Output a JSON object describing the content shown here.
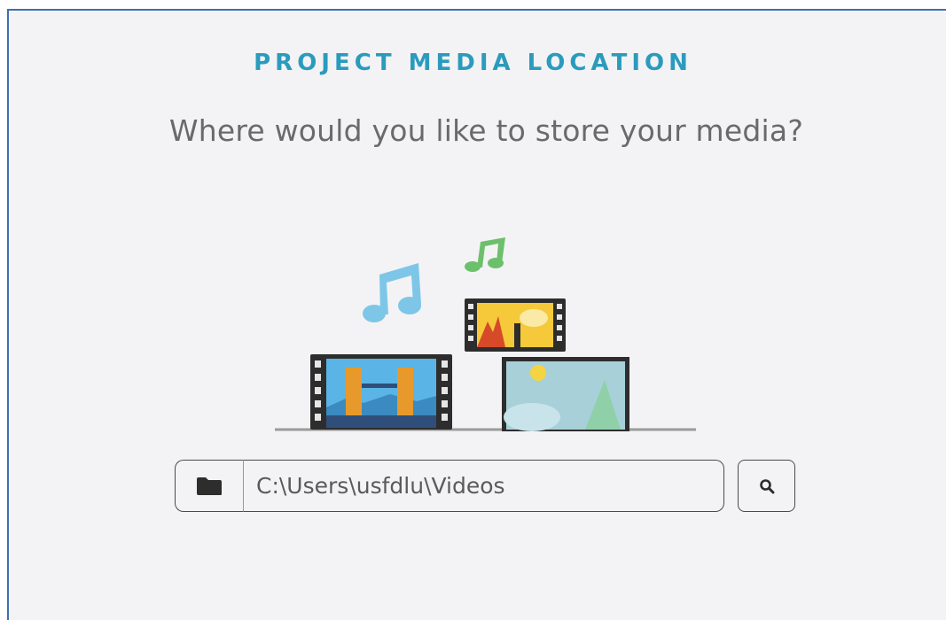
{
  "dialog": {
    "title": "PROJECT MEDIA LOCATION",
    "question": "Where would you like to store your media?"
  },
  "media_location": {
    "path_value": "C:\\Users\\usfdlu\\Videos",
    "browse_icon": "folder-icon",
    "search_icon": "search-icon"
  },
  "colors": {
    "accent": "#2b9bbd",
    "panel_background": "#f3f3f5",
    "music_note_blue": "#7ec6e8",
    "music_note_green": "#6cc06c"
  }
}
